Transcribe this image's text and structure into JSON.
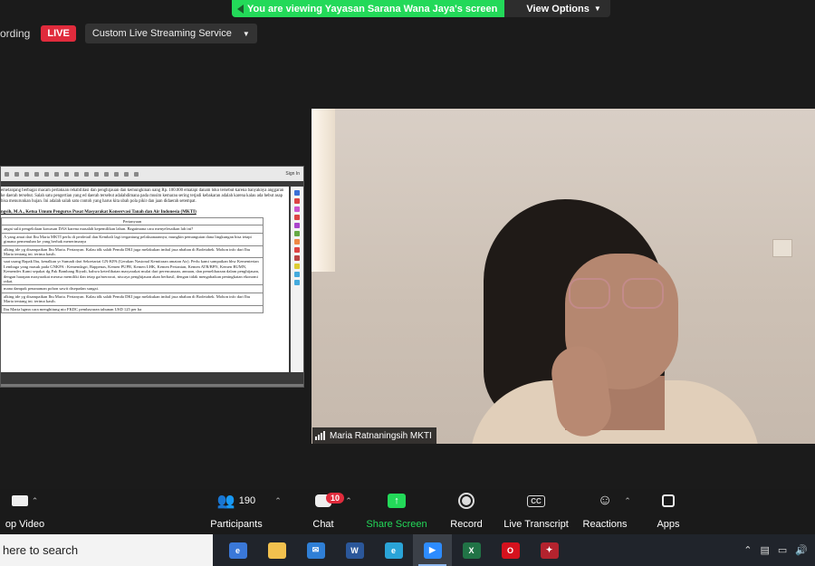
{
  "banner": {
    "viewing_text": "You are viewing Yayasan Sarana Wana Jaya's screen",
    "view_options_label": "View Options"
  },
  "recording": {
    "status_text": "ording",
    "live_badge": "LIVE",
    "stream_service": "Custom Live Streaming Service"
  },
  "shared_doc": {
    "signin": "Sign In",
    "paragraph": "emelanjang berbagai macam perlakuan rehabilitasi dan penghijauan dan kemungkinan uang Rp. 100.000 ematapi danam toko tersebut karena banyaknya anggaran ke daerah tersebut. Salah satu pengertian yang ed daerah tersebut adalahdimana pada musim kemarau sering terjadi kebakaran adalah karena kalau ada hebut asap bisa menurunkan hujan. Ini adalah salah satu contoh yang harus kita ubah pola pikir dan jaan didaerah setempat.",
    "heading": "ngsih, M.A., Ketua Umum Pengurus Pusat Masyarakat Konservasi Tanah dan Air Indonesia (MKTI)",
    "table_header": "Pertanyaan",
    "rows": [
      "angat sulit pengelolaan kawasan DAS karena masalah kepemilikan lahan. Bagaimana cara menyelesaikan lah ini?",
      "A yang amat dari Ibu Maria MKTI perlu di perdetail dan Kembali lagi tergantung pelaksanaannya, mungkin pemangutan dana lingkungan bisa tetapi gimana pemenuhan ke yang berhak menerimanya",
      "alking ide yg disampaikan Ibu Maria. Pertanyan. Kalau tdk salah Pemda DKI juga melakukan imbal jasa nbahan di Bodetabek. Mohon info dari Ibu Maria tentang ini. terima kasih.",
      "saat usang Bapak Ibu, kenalkan yr Sumadi dari Sekretariat GN-KPA (Gerakan Nasional Kemitraan amatan Air). Perlu kami sampaikan bhw Kementerian Lembaga yang masuk pada GNKPA : Kemendagri, Bappenas, Kemen PUPR, Kemen LHK, Kemen Pertanian, Kemen ATR/BPN, Kemen BUMN, Kemendes Kami sepakat dg Pak Bambang Riyadi, bahwa keterlibatan masyarakat mulai dari perencanaan, annaan, dan pemeliharaan dalam penghijauan, dengan harapan masyarakat merasa memiliki dan tetap ga/merawat, niscaya penghijauan akan berhasil, dengan tidak mengabaikan peningkatan ekonomi rakat.",
      "mana dampak penanaman pohon sawit disepadan sungai.",
      "alking ide yg disampaikan Ibu Maria. Pertanyan. Kalau tdk salah Pemda DKI juga melakukan imbal jasa nbahan di Bodetabek. Mohon info dari Ibu Maria tentang ini. terima kasih.",
      "Ibu Maria bgmn cara menghitung nio  FKDC pembayaran tahunan USD 125 per ha"
    ]
  },
  "presenter": {
    "name": "Maria Ratnaningsih MKTI"
  },
  "toolbar": {
    "video_label": "op Video",
    "participants_label": "Participants",
    "participants_count": "190",
    "chat_label": "Chat",
    "chat_badge": "10",
    "share_label": "Share Screen",
    "record_label": "Record",
    "transcript_label": "Live Transcript",
    "transcript_icon": "CC",
    "reactions_label": "Reactions",
    "apps_label": "Apps"
  },
  "taskbar": {
    "search_placeholder": "here to search",
    "apps": [
      {
        "name": "edge-legacy",
        "color": "#3a78d8",
        "glyph": "e"
      },
      {
        "name": "file-explorer",
        "color": "#f2c14e",
        "glyph": ""
      },
      {
        "name": "mail",
        "color": "#2f7fd6",
        "glyph": "✉"
      },
      {
        "name": "word",
        "color": "#2b579a",
        "glyph": "W"
      },
      {
        "name": "edge",
        "color": "#2aa4d8",
        "glyph": "e"
      },
      {
        "name": "zoom",
        "color": "#2d8cff",
        "glyph": "▶"
      },
      {
        "name": "excel",
        "color": "#217346",
        "glyph": "X"
      },
      {
        "name": "opera",
        "color": "#d5121e",
        "glyph": "O"
      },
      {
        "name": "other-app",
        "color": "#b3232e",
        "glyph": "✦"
      }
    ],
    "active_app": "zoom"
  },
  "colors": {
    "accent_green": "#23d959",
    "live_red": "#e02b3c"
  }
}
